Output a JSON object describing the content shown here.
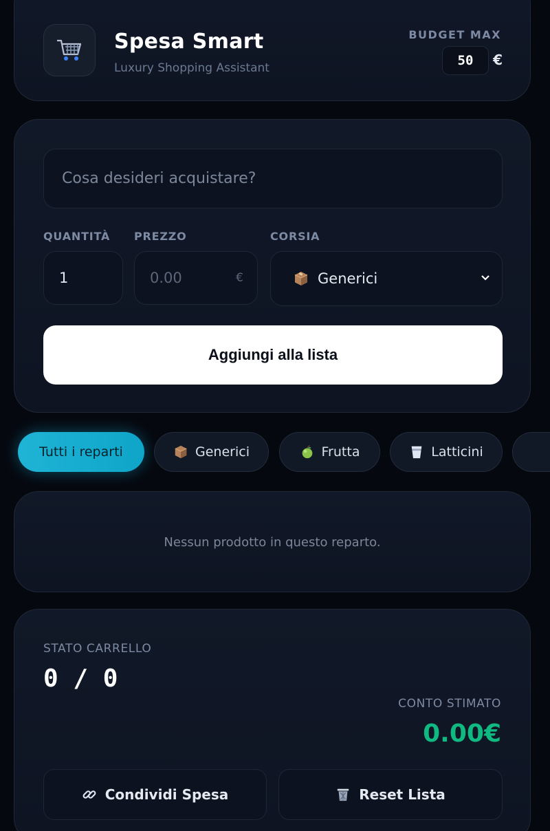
{
  "header": {
    "title": "Spesa Smart",
    "subtitle": "Luxury Shopping Assistant",
    "budget_label": "BUDGET MAX",
    "budget_value": "50",
    "budget_currency": "€",
    "logo_icon": "shopping-cart-icon"
  },
  "form": {
    "search_placeholder": "Cosa desideri acquistare?",
    "quantity_label": "QUANTITÀ",
    "quantity_value": "1",
    "price_label": "PREZZO",
    "price_placeholder": "0.00",
    "price_currency": "€",
    "aisle_label": "CORSIA",
    "aisle_selected": "Generici",
    "aisle_icon": "package-icon",
    "add_button": "Aggiungi alla lista"
  },
  "filters": [
    {
      "label": "Tutti i reparti",
      "active": true
    },
    {
      "label": "Generici",
      "icon": "package-icon"
    },
    {
      "label": "Frutta",
      "icon": "apple-icon"
    },
    {
      "label": "Latticini",
      "icon": "cup-icon"
    }
  ],
  "list": {
    "empty_message": "Nessun prodotto in questo reparto."
  },
  "stats": {
    "cart_label": "STATO CARRELLO",
    "cart_value": "0 / 0",
    "total_label": "CONTO STIMATO",
    "total_value": "0.00€",
    "share_button": "Condividi Spesa",
    "reset_button": "Reset Lista"
  },
  "colors": {
    "background": "#06080f",
    "accent": "#0ea5c9",
    "total_green": "#10b981"
  }
}
